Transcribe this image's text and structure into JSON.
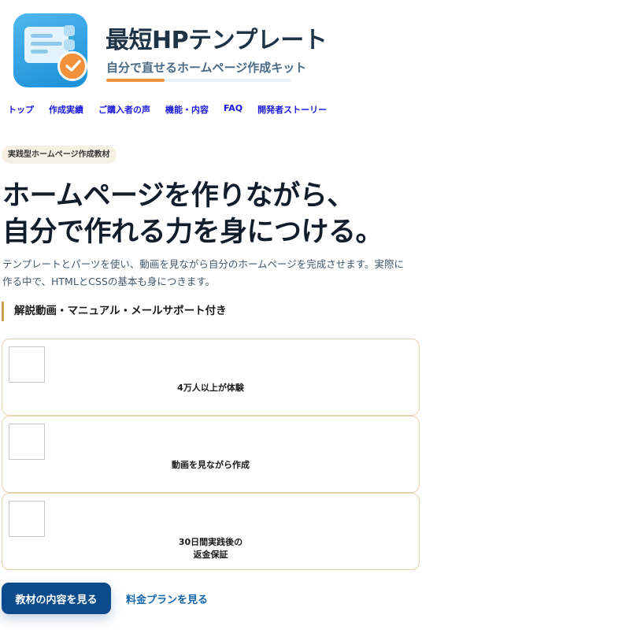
{
  "brand": {
    "title": "最短HPテンプレート",
    "subtitle": "自分で直せるホームページ作成キット",
    "accent_color": "#f1913a",
    "icon": "template-check-logo-icon"
  },
  "nav": {
    "items": [
      {
        "label": "トップ"
      },
      {
        "label": "作成実績"
      },
      {
        "label": "ご購入者の声"
      },
      {
        "label": "機能・内容"
      },
      {
        "label": "FAQ"
      },
      {
        "label": "開発者ストーリー"
      }
    ]
  },
  "hero": {
    "tag": "実践型ホームページ作成教材",
    "headline_line1": "ホームページを作りながら、",
    "headline_line2": "自分で作れる力を身につける。",
    "lead": "テンプレートとパーツを使い、動画を見ながら自分のホームページを完成させます。実際に作る中で、HTMLとCSSの基本も身につきます。",
    "support": "解説動画・マニュアル・メールサポート付き"
  },
  "features": [
    {
      "line1": "4万人以上が体験",
      "line2": ""
    },
    {
      "line1": "動画を見ながら作成",
      "line2": ""
    },
    {
      "line1": "30日間実践後の",
      "line2": "返金保証"
    }
  ],
  "cta": {
    "primary_label": "教材の内容を見る",
    "secondary_label": "料金プランを見る",
    "primary_color": "#0b4a8b"
  }
}
